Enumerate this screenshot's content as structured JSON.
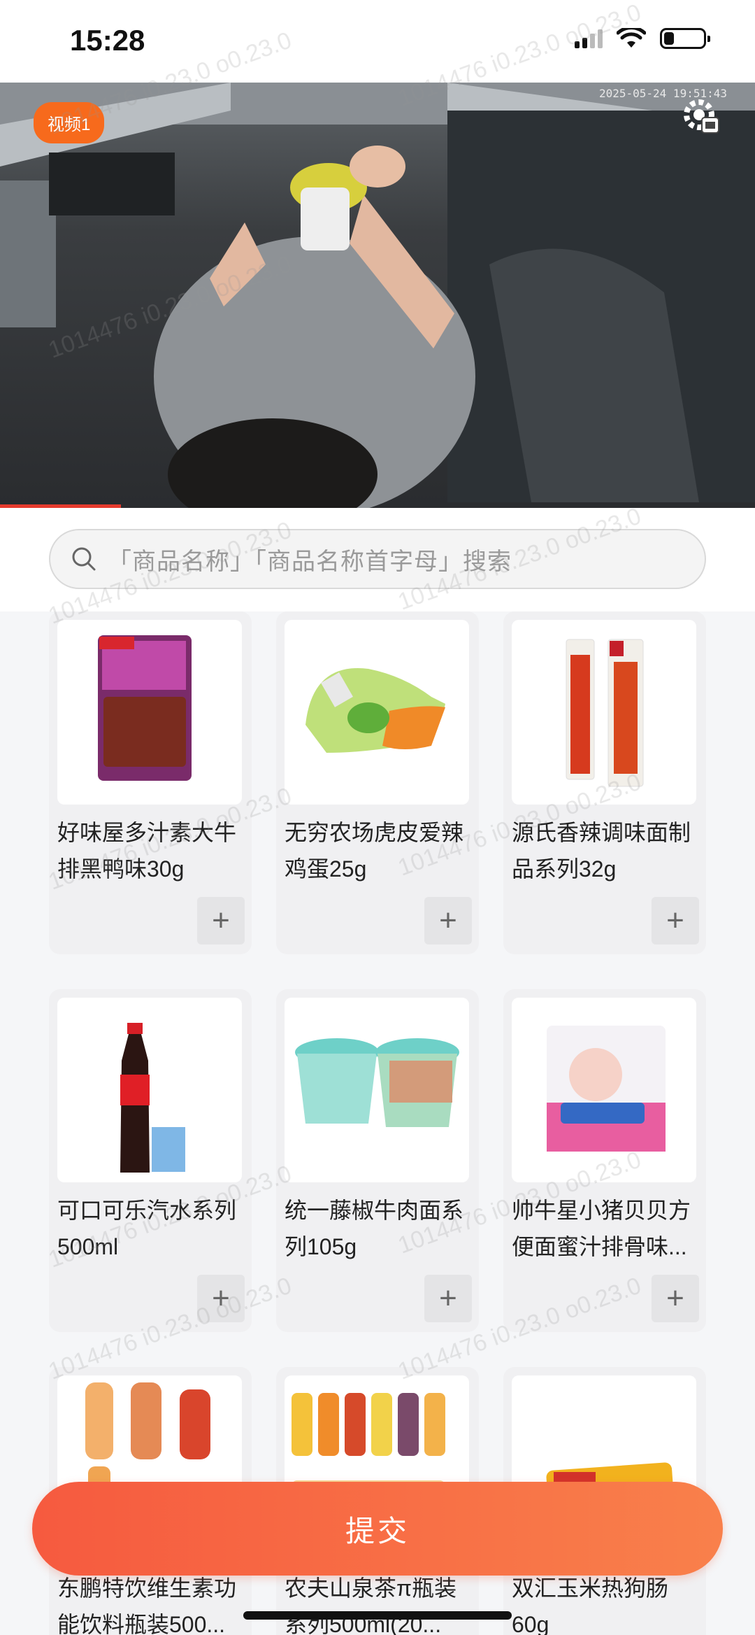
{
  "status_bar": {
    "time": "15:28"
  },
  "video": {
    "badge": "视频1",
    "timestamp": "2025-05-24 19:51:43",
    "progress": 0.16
  },
  "search": {
    "placeholder": "「商品名称」「商品名称首字母」搜索"
  },
  "products": [
    {
      "name": "好味屋多汁素大牛排黑鸭味30g",
      "add": "+",
      "icon": "meat-snack-pack"
    },
    {
      "name": "无穷农场虎皮爱辣鸡蛋25g",
      "add": "+",
      "icon": "egg-pack"
    },
    {
      "name": "源氏香辣调味面制品系列32g",
      "add": "+",
      "icon": "spicy-strip-pack"
    },
    {
      "name": "可口可乐汽水系列500ml",
      "add": "+",
      "icon": "cola-bottle"
    },
    {
      "name": "统一藤椒牛肉面系列105g",
      "add": "+",
      "icon": "noodle-cup"
    },
    {
      "name": "帅牛星小猪贝贝方便面蜜汁排骨味...",
      "add": "+",
      "icon": "noodle-bag"
    },
    {
      "name": "东鹏特饮维生素功能饮料瓶装500...",
      "add": "+",
      "icon": "drink-bottles"
    },
    {
      "name": "农夫山泉茶π瓶装系列500ml(20...",
      "add": "+",
      "icon": "tea-bottles"
    },
    {
      "name": "双汇玉米热狗肠60g",
      "add": "+",
      "icon": "sausage-pack"
    }
  ],
  "submit": {
    "label": "提交"
  },
  "watermark": "1014476 i0.23.0 o0.23.0",
  "colors": {
    "accent": "#f65a3f",
    "badge": "#f76a1c"
  }
}
